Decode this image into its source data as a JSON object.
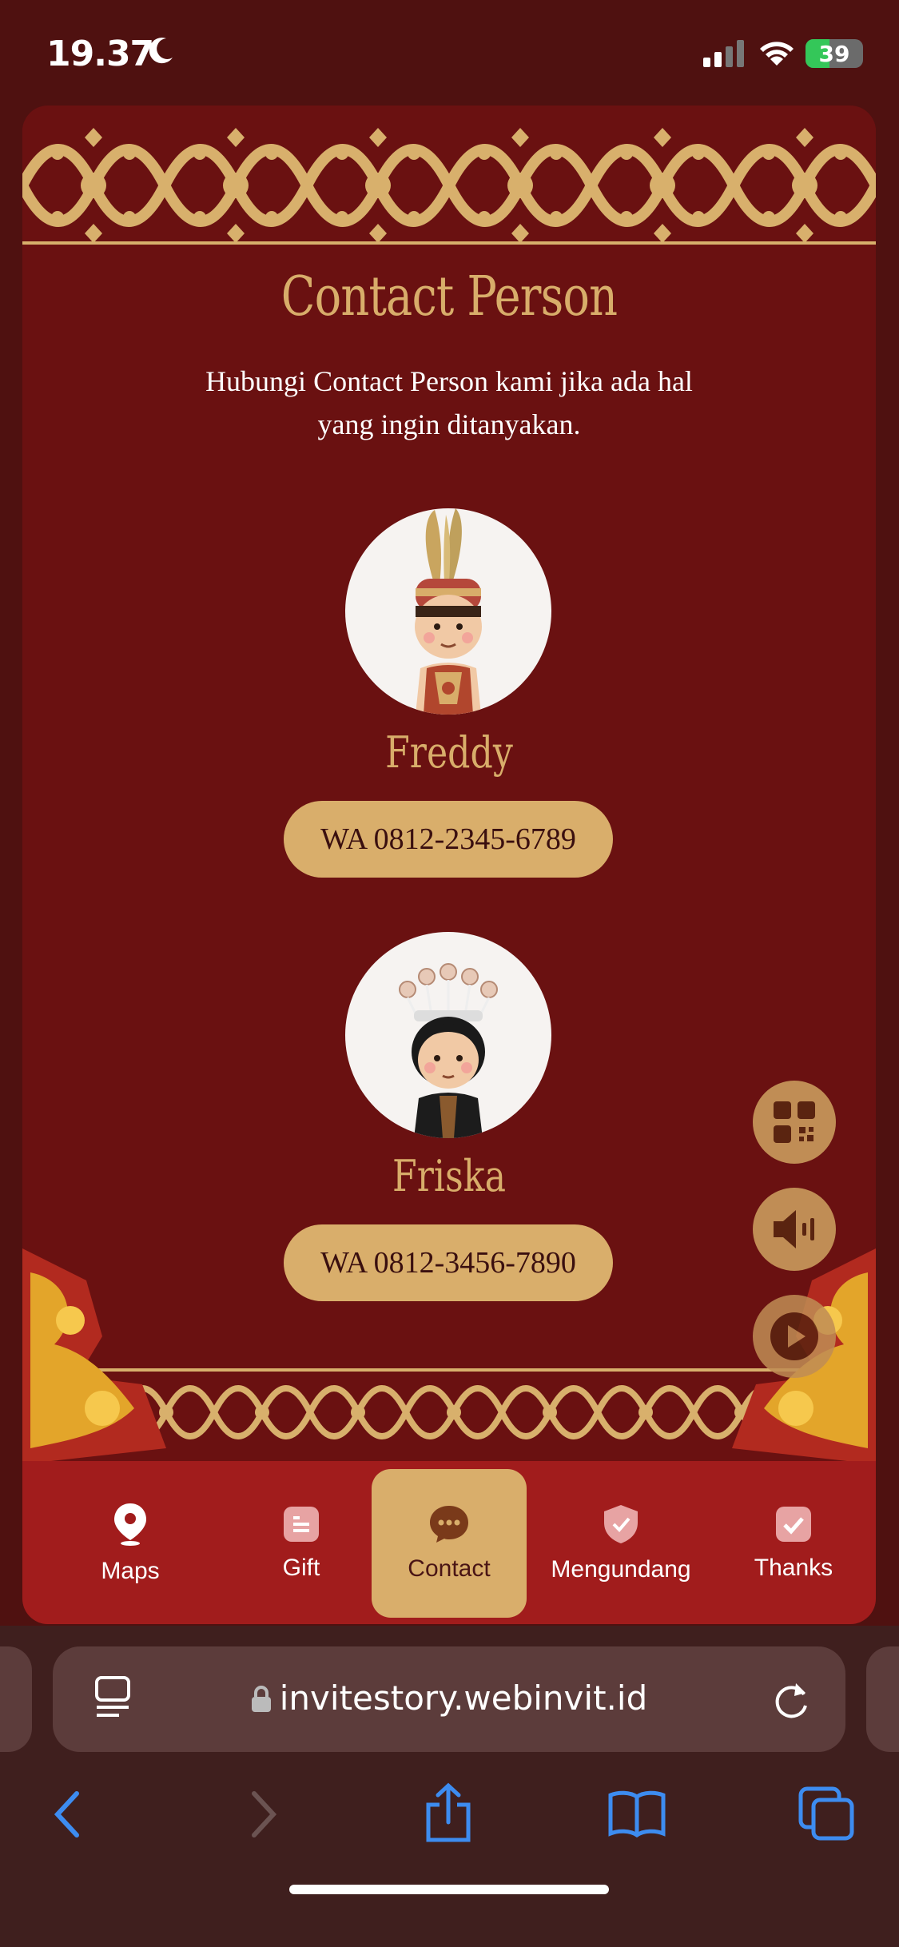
{
  "status_bar": {
    "time": "19.37",
    "battery": "39"
  },
  "section": {
    "title": "Contact Person",
    "subtitle_line1": "Hubungi Contact Person kami jika ada hal",
    "subtitle_line2": "yang ingin ditanyakan."
  },
  "contacts": [
    {
      "name": "Freddy",
      "wa_label": "WA 0812-2345-6789"
    },
    {
      "name": "Friska",
      "wa_label": "WA 0812-3456-7890"
    }
  ],
  "nav": {
    "items": [
      {
        "label": "Maps",
        "icon": "map-pin-icon"
      },
      {
        "label": "Gift",
        "icon": "gift-icon"
      },
      {
        "label": "Contact",
        "icon": "chat-icon",
        "active": true
      },
      {
        "label": "Mengundang",
        "icon": "shield-check-icon"
      },
      {
        "label": "Thanks",
        "icon": "check-square-icon"
      }
    ]
  },
  "browser": {
    "url": "invitestory.webinvit.id"
  },
  "colors": {
    "page": "#6a1111",
    "gold": "#d8ad6a",
    "nav": "#a11c1c"
  }
}
